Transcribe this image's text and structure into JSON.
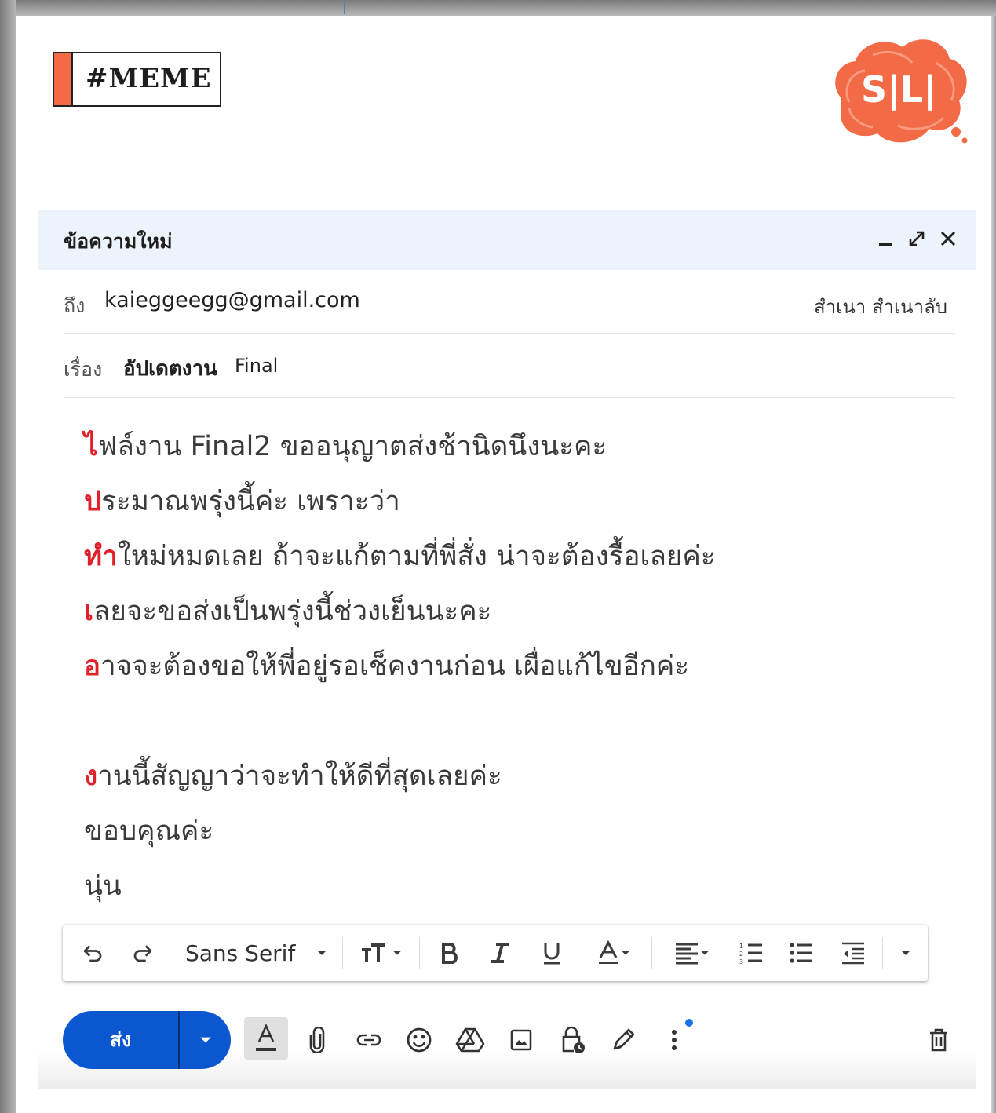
{
  "tag": {
    "label": "#MEME"
  },
  "logo": {
    "text": "S|L|"
  },
  "compose": {
    "title": "ข้อความใหม่",
    "to_label": "ถึง",
    "to_value": "kaieggeegg@gmail.com",
    "cc_bcc": "สำเนา สำเนาลับ",
    "subject_label": "เรื่อง",
    "subject_value_thai": "อัปเดตงาน",
    "subject_value_en": "Final"
  },
  "body": {
    "lines": [
      {
        "first": "ไ",
        "rest": "ฟล์งาน Final2 ขออนุญาตส่งช้านิดนึงนะคะ"
      },
      {
        "first": "ป",
        "rest": "ระมาณพรุ่งนี้ค่ะ เพราะว่า"
      },
      {
        "first": "ทำ",
        "rest": "ใหม่หมดเลย ถ้าจะแก้ตามที่พี่สั่ง น่าจะต้องรื้อเลยค่ะ"
      },
      {
        "first": "เ",
        "rest": "ลยจะขอส่งเป็นพรุ่งนี้ช่วงเย็นนะคะ"
      },
      {
        "first": "อ",
        "rest": "าจจะต้องขอให้พี่อยู่รอเช็คงานก่อน เผื่อแก้ไขอีกค่ะ"
      },
      {
        "first": "ง",
        "rest": "านนี้สัญญาว่าจะทำให้ดีที่สุดเลยค่ะ"
      }
    ],
    "thanks": "ขอบคุณค่ะ",
    "signature": "นุ่น"
  },
  "toolbar": {
    "font": "Sans Serif"
  },
  "send": {
    "label": "ส่ง"
  },
  "colors": {
    "accent": "#f26a46",
    "send": "#0b57d0",
    "highlight": "#e0202a",
    "header_bg": "#edf3fb"
  },
  "icons": [
    "undo-icon",
    "redo-icon",
    "font-size-icon",
    "bold-icon",
    "italic-icon",
    "underline-icon",
    "text-color-icon",
    "align-icon",
    "numbered-list-icon",
    "bulleted-list-icon",
    "indent-less-icon",
    "more-formatting-icon",
    "formatting-options-icon",
    "attach-icon",
    "link-icon",
    "emoji-icon",
    "drive-icon",
    "photo-icon",
    "confidential-icon",
    "signature-icon",
    "more-options-icon",
    "trash-icon"
  ]
}
